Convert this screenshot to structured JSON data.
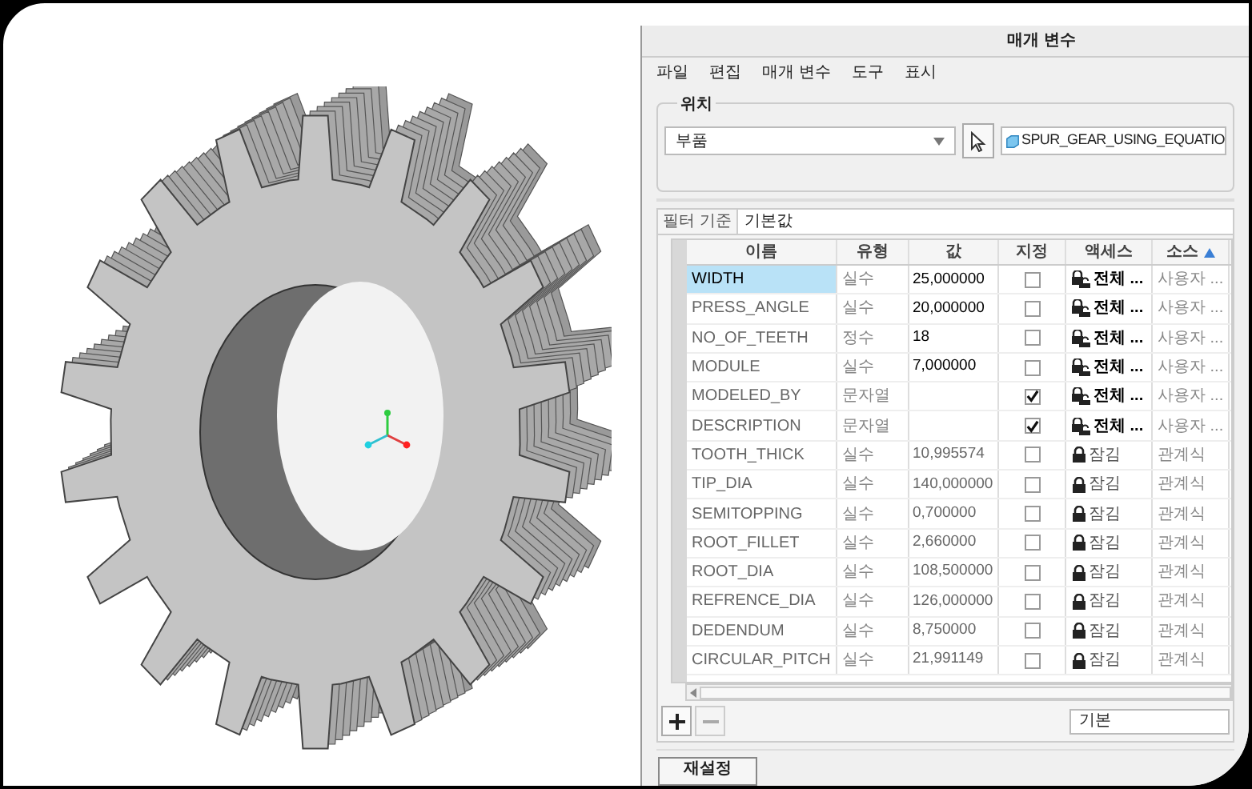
{
  "window": {
    "title": "매개 변수"
  },
  "menu": [
    "파일",
    "편집",
    "매개 변수",
    "도구",
    "표시"
  ],
  "location": {
    "label": "위치",
    "type_select": "부품",
    "model": "SPUR_GEAR_USING_EQUATIO"
  },
  "filter": {
    "label": "필터 기준",
    "value": "기본값"
  },
  "table": {
    "columns": [
      {
        "label": "이름",
        "sorted": false
      },
      {
        "label": "유형",
        "sorted": false
      },
      {
        "label": "값",
        "sorted": false
      },
      {
        "label": "지정",
        "sorted": false
      },
      {
        "label": "액세스",
        "sorted": false
      },
      {
        "label": "소스",
        "sorted": true
      }
    ],
    "rows": [
      {
        "name": "WIDTH",
        "type": "실수",
        "value": "25,000000",
        "designated": false,
        "locked": false,
        "access": "전체 ...",
        "source": "사용자 ...",
        "selected": true
      },
      {
        "name": "PRESS_ANGLE",
        "type": "실수",
        "value": "20,000000",
        "designated": false,
        "locked": false,
        "access": "전체 ...",
        "source": "사용자 ...",
        "selected": false
      },
      {
        "name": "NO_OF_TEETH",
        "type": "정수",
        "value": "18",
        "designated": false,
        "locked": false,
        "access": "전체 ...",
        "source": "사용자 ...",
        "selected": false
      },
      {
        "name": "MODULE",
        "type": "실수",
        "value": "7,000000",
        "designated": false,
        "locked": false,
        "access": "전체 ...",
        "source": "사용자 ...",
        "selected": false
      },
      {
        "name": "MODELED_BY",
        "type": "문자열",
        "value": "",
        "designated": true,
        "locked": false,
        "access": "전체 ...",
        "source": "사용자 ...",
        "selected": false
      },
      {
        "name": "DESCRIPTION",
        "type": "문자열",
        "value": "",
        "designated": true,
        "locked": false,
        "access": "전체 ...",
        "source": "사용자 ...",
        "selected": false
      },
      {
        "name": "TOOTH_THICK",
        "type": "실수",
        "value": "10,995574",
        "designated": false,
        "locked": true,
        "access": "잠김",
        "source": "관계식",
        "selected": false
      },
      {
        "name": "TIP_DIA",
        "type": "실수",
        "value": "140,000000",
        "designated": false,
        "locked": true,
        "access": "잠김",
        "source": "관계식",
        "selected": false
      },
      {
        "name": "SEMITOPPING",
        "type": "실수",
        "value": "0,700000",
        "designated": false,
        "locked": true,
        "access": "잠김",
        "source": "관계식",
        "selected": false
      },
      {
        "name": "ROOT_FILLET",
        "type": "실수",
        "value": "2,660000",
        "designated": false,
        "locked": true,
        "access": "잠김",
        "source": "관계식",
        "selected": false
      },
      {
        "name": "ROOT_DIA",
        "type": "실수",
        "value": "108,500000",
        "designated": false,
        "locked": true,
        "access": "잠김",
        "source": "관계식",
        "selected": false
      },
      {
        "name": "REFRENCE_DIA",
        "type": "실수",
        "value": "126,000000",
        "designated": false,
        "locked": true,
        "access": "잠김",
        "source": "관계식",
        "selected": false
      },
      {
        "name": "DEDENDUM",
        "type": "실수",
        "value": "8,750000",
        "designated": false,
        "locked": true,
        "access": "잠김",
        "source": "관계식",
        "selected": false
      },
      {
        "name": "CIRCULAR_PITCH",
        "type": "실수",
        "value": "21,991149",
        "designated": false,
        "locked": true,
        "access": "잠김",
        "source": "관계식",
        "selected": false
      }
    ]
  },
  "view_select": "기본",
  "reset_button": "재설정"
}
